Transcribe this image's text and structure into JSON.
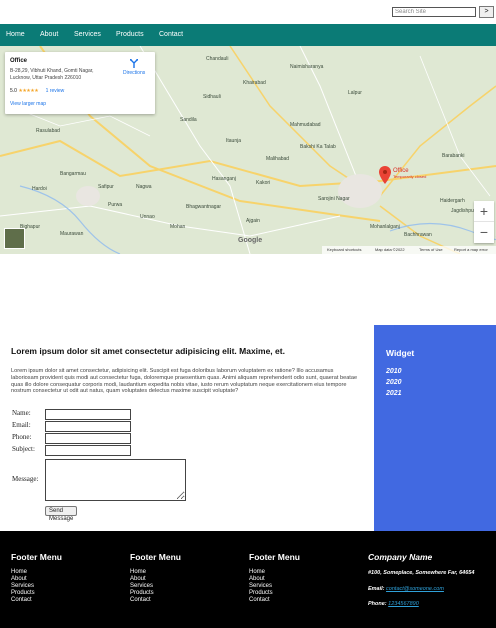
{
  "search": {
    "placeholder": "Search Site",
    "button_label": ">"
  },
  "nav": {
    "items": [
      "Home",
      "About",
      "Services",
      "Products",
      "Contact"
    ]
  },
  "map": {
    "card": {
      "title": "Office",
      "address": "B-28,29, Vibhuti Khand, Gomti Nagar, Lucknow, Uttar Pradesh 226010",
      "rating": "5.0",
      "stars": "★★★★★",
      "reviews": "1 review",
      "larger_map": "View larger map",
      "directions": "Directions"
    },
    "places": [
      "Chandauli",
      "Sidhauli",
      "Sandila",
      "Mahmudabad",
      "Barabanki",
      "Bakshi Ka Talab",
      "Sarojini Nagar",
      "Malihabad",
      "Mohanlalganj",
      "Unnao",
      "Bangarmau",
      "Purwa",
      "Haidergarh",
      "Bachhrawan",
      "Safipur",
      "Rasulabad",
      "Nagwa",
      "Mohan",
      "Bhagwantnagar",
      "Hasanganj",
      "Jagdishpur",
      "Maurawan",
      "Itaunja",
      "Bighapur",
      "Kakori",
      "Hardoi",
      "Khairabad",
      "Naimisharanya",
      "Lalpur",
      "Ajgain"
    ],
    "pin_label": "Office",
    "pin_sub": "Temporarily closed",
    "zoom_in": "+",
    "zoom_out": "−",
    "google": "Google",
    "attribution": {
      "shortcuts": "Keyboard shortcuts",
      "data": "Map data ©2022",
      "terms": "Terms of Use",
      "report": "Report a map error"
    }
  },
  "content": {
    "heading": "Lorem ipsum dolor sit amet consectetur adipisicing elit. Maxime, et.",
    "body": "Lorem ipsum dolor sit amet consectetur, adipisicing elit. Suscipit est fuga doloribus laborum voluptatem ex ratione? Illo accusamus laboriosam provident quis modi aut consectetur fuga, doloremque praesentium quas. Animi aliquam reprehenderit odio sunt, quaerat beatae quas illo dolore consequatur corporis modi, laudantium expedita nobis vitae, iusto rerum voluptatum neque exercitationem eius tempore nostrum consectetur ut odit aut natus, quam voluptates delectus maxime suscipit voluptate?",
    "form": {
      "name_label": "Name:",
      "email_label": "Email:",
      "phone_label": "Phone:",
      "subject_label": "Subject:",
      "message_label": "Message:",
      "send_label": "Send Message"
    }
  },
  "widget": {
    "title": "Widget",
    "years": [
      "2010",
      "2020",
      "2021"
    ]
  },
  "footer": {
    "columns": [
      {
        "heading": "Footer Menu",
        "links": [
          "Home",
          "About",
          "Services",
          "Products",
          "Contact"
        ]
      },
      {
        "heading": "Footer Menu",
        "links": [
          "Home",
          "About",
          "Services",
          "Products",
          "Contact"
        ]
      },
      {
        "heading": "Footer Menu",
        "links": [
          "Home",
          "About",
          "Services",
          "Products",
          "Contact"
        ]
      }
    ],
    "company": {
      "heading": "Company Name",
      "address": "#100, Someplace, Somewhere Far, 64654",
      "email_label": "Email:",
      "email": "contact@someone.com",
      "phone_label": "Phone:",
      "phone": "1234567890"
    }
  },
  "colors": {
    "nav": "#0b7b76",
    "widget": "#4169e1",
    "footer": "#000000",
    "link": "#2fa0d8"
  }
}
